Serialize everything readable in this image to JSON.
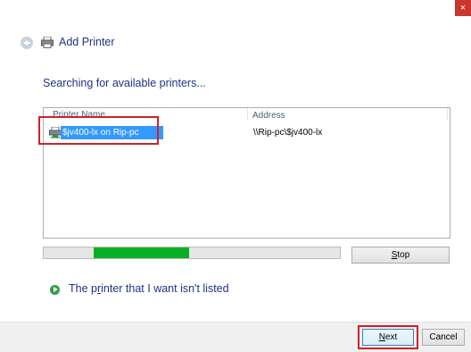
{
  "window": {
    "title": "Add Printer",
    "close_glyph": "×",
    "icons": {
      "back": "back-arrow-icon",
      "title": "printer-icon",
      "close": "close-icon"
    }
  },
  "page": {
    "heading": "Searching for available printers..."
  },
  "printer_list": {
    "columns": [
      "Printer Name",
      "Address"
    ],
    "rows": [
      {
        "name": "$jv400-lx on Rip-pc",
        "address": "\\\\Rip-pc\\$jv400-lx",
        "selected": true,
        "icon": "network-printer-icon"
      }
    ]
  },
  "search_progress": {
    "fill_start": 0.17,
    "fill_end": 0.49,
    "color": "#06b025"
  },
  "buttons": {
    "stop": {
      "pre": "",
      "key": "S",
      "post": "top"
    },
    "next": {
      "pre": "",
      "key": "N",
      "post": "ext"
    },
    "cancel": "Cancel"
  },
  "not_listed_link": {
    "pre": "The p",
    "key": "r",
    "post": "inter that I want isn't listed",
    "icon": "green-arrow-icon"
  },
  "colors": {
    "accent": "#1e3287",
    "selection": "#3399ff",
    "callout": "#d0202a"
  }
}
